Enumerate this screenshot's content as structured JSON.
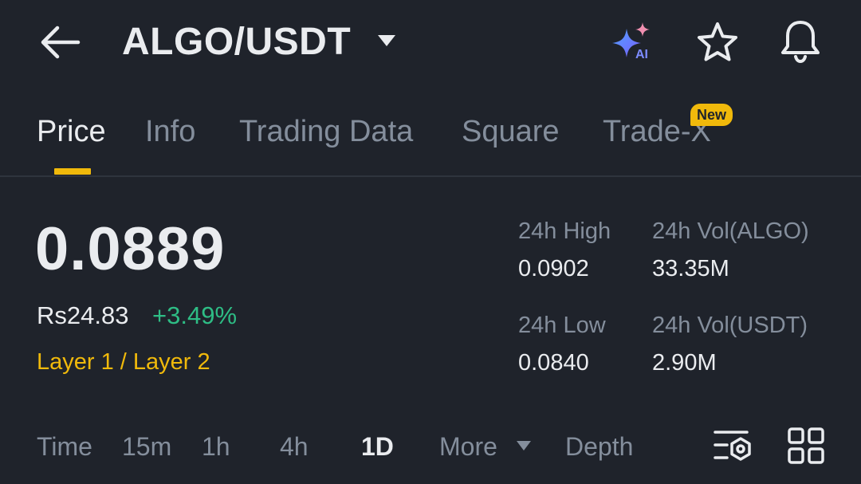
{
  "header": {
    "pair": "ALGO/USDT",
    "icons": [
      "back-arrow-icon",
      "caret-down-icon",
      "ai-sparkle-icon",
      "star-icon",
      "bell-icon"
    ],
    "ai_icon_text": "AI"
  },
  "tabs": [
    {
      "label": "Price",
      "active": true
    },
    {
      "label": "Info",
      "active": false
    },
    {
      "label": "Trading Data",
      "active": false
    },
    {
      "label": "Square",
      "active": false
    },
    {
      "label": "Trade-X",
      "active": false,
      "badge": "New"
    }
  ],
  "price": {
    "last": "0.0889",
    "fiat": "Rs24.83",
    "change": "+3.49%",
    "tag": "Layer 1 / Layer 2"
  },
  "stats": {
    "high_label": "24h High",
    "high_value": "0.0902",
    "vol_base_label": "24h Vol(ALGO)",
    "vol_base_value": "33.35M",
    "low_label": "24h Low",
    "low_value": "0.0840",
    "vol_quote_label": "24h Vol(USDT)",
    "vol_quote_value": "2.90M"
  },
  "intervals": {
    "time": "Time",
    "m15": "15m",
    "h1": "1h",
    "h4": "4h",
    "d1": "1D",
    "more": "More",
    "depth": "Depth",
    "active": "1D"
  },
  "colors": {
    "background": "#1f232b",
    "accent": "#f0b90b",
    "positive": "#2ebd85",
    "muted": "#848e9c",
    "text": "#eaecef"
  }
}
